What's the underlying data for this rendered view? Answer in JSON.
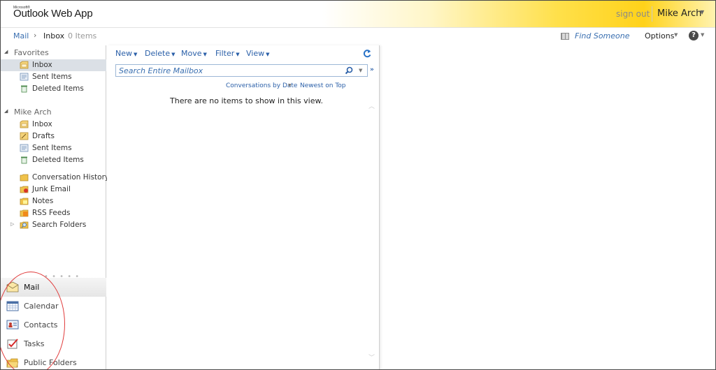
{
  "header": {
    "logo_small": "Microsoft®",
    "logo": "Outlook Web App",
    "sign_out": "sign out",
    "user_name": "Mike Arch"
  },
  "breadcrumb": {
    "root": "Mail",
    "separator": "›",
    "current": "Inbox",
    "count": "0 Items",
    "find_someone": "Find Someone",
    "options": "Options",
    "help": "?"
  },
  "favorites": {
    "title": "Favorites",
    "items": [
      {
        "label": "Inbox",
        "icon": "inbox-folder-icon",
        "selected": true
      },
      {
        "label": "Sent Items",
        "icon": "sent-items-icon"
      },
      {
        "label": "Deleted Items",
        "icon": "deleted-items-icon"
      }
    ]
  },
  "mailbox": {
    "title": "Mike Arch",
    "items": [
      {
        "label": "Inbox",
        "icon": "inbox-folder-icon"
      },
      {
        "label": "Drafts",
        "icon": "drafts-icon"
      },
      {
        "label": "Sent Items",
        "icon": "sent-items-icon"
      },
      {
        "label": "Deleted Items",
        "icon": "deleted-items-icon"
      },
      {
        "label": "Conversation History",
        "icon": "folder-icon"
      },
      {
        "label": "Junk Email",
        "icon": "junk-email-icon"
      },
      {
        "label": "Notes",
        "icon": "notes-icon"
      },
      {
        "label": "RSS Feeds",
        "icon": "rss-icon"
      },
      {
        "label": "Search Folders",
        "icon": "search-folder-icon"
      }
    ]
  },
  "nav_buttons": [
    {
      "label": "Mail",
      "icon": "mail-icon",
      "selected": true
    },
    {
      "label": "Calendar",
      "icon": "calendar-icon"
    },
    {
      "label": "Contacts",
      "icon": "contacts-icon"
    },
    {
      "label": "Tasks",
      "icon": "tasks-icon"
    },
    {
      "label": "Public Folders",
      "icon": "public-folders-icon"
    }
  ],
  "toolbar": {
    "new": "New",
    "delete": "Delete",
    "move": "Move",
    "filter": "Filter",
    "view": "View"
  },
  "search": {
    "placeholder": "Search Entire Mailbox"
  },
  "sort": {
    "by": "Conversations by Date",
    "order": "Newest on Top"
  },
  "list": {
    "empty_message": "There are no items to show in this view."
  },
  "colors": {
    "accent": "#3a6fb0",
    "header_gold": "#ffd21a",
    "annotation_red": "#e03a3a",
    "selected_bg": "#dbe0e6"
  }
}
